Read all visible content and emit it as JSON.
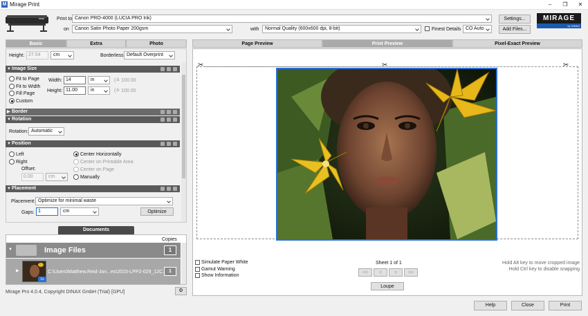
{
  "window": {
    "app_icon": "M",
    "title": "Mirage Print",
    "minimize": "–",
    "maximize": "❐",
    "close": "✕"
  },
  "header": {
    "print_to_label": "Print to",
    "printer": "Canon PRO-4000 (LUCIA PRO Ink)",
    "on_label": "on",
    "paper": "Canon Satin Photo Paper 200gsm",
    "with_label": "with",
    "quality": "Normal Quality (600x600 dpi, 8-bit)",
    "finest_details": "Finest Details",
    "color_mode": "CO Auto",
    "settings_button": "Settings...",
    "add_files_button": "Add Files...",
    "brand": "MIRAGE",
    "brand_sub": "by DINAX"
  },
  "left_tabs": [
    "Basic",
    "Extra",
    "Photo"
  ],
  "basic": {
    "height_label": "Height:",
    "height_value": "27.54",
    "height_unit": "cm",
    "borderless_label": "Borderless:",
    "borderless_value": "Default Overprint"
  },
  "sections": {
    "image_size": "Image Size",
    "border": "Border",
    "rotation": "Rotation",
    "position": "Position",
    "placement": "Placement"
  },
  "image_size": {
    "options": [
      "Fit to Page",
      "Fit to Width",
      "Fill Page",
      "Custom"
    ],
    "width_label": "Width:",
    "width_value": "14",
    "width_unit": "in",
    "width_pct": "(≙ 100.00",
    "height_label": "Height:",
    "height_value": "11.00",
    "height_unit": "in",
    "height_pct": "(≙ 100.00"
  },
  "rotation": {
    "label": "Rotation:",
    "value": "Automatic"
  },
  "position": {
    "left": "Left",
    "right": "Right",
    "offset_label": "Offset:",
    "offset_value": "0.00",
    "offset_unit": "cm",
    "center_h": "Center Horizontally",
    "center_printable": "Center on Printable Area",
    "center_page": "Center on Page",
    "manually": "Manually"
  },
  "placement": {
    "label": "Placement:",
    "value": "Optimize for minimal waste",
    "gaps_label": "Gaps:",
    "gaps_value": "1",
    "gaps_unit": "cm",
    "optimize_button": "Optimize"
  },
  "documents": {
    "tab": "Documents",
    "copies_header": "Copies",
    "group_name": "Image Files",
    "group_copies": "1",
    "file_path": "C:\\Users\\Matthew.Reid-Jon...es\\2015-LPP2-029_12C.tif",
    "file_copies": "1",
    "file_badge": "1x"
  },
  "footer": {
    "copyright": "Mirage Pro 4.0.4, Copyright DINAX GmbH (Trial) [GPU]",
    "gear_icon": "⚙"
  },
  "preview_tabs": [
    "Page Preview",
    "Print Preview",
    "Pixel-Exact Preview"
  ],
  "preview": {
    "scissors_icon": "✂"
  },
  "options": {
    "simulate_paper_white": "Simulate Paper White",
    "gamut_warning": "Gamut Warning",
    "show_information": "Show Information",
    "sheet_text": "Sheet 1 of 1",
    "nav_first": "<<",
    "nav_prev": "<",
    "nav_next": ">",
    "nav_last": ">>",
    "loupe_button": "Loupe",
    "hint1": "Hold Alt key to move cropped image",
    "hint2": "Hold Ctrl key to disable snapping"
  },
  "bottom_buttons": {
    "help": "Help",
    "close": "Close",
    "print": "Print"
  },
  "colors": {
    "accent_selection": "#2a6fd6",
    "section_header": "#5a5a5a",
    "brand_blue": "#1a5bb0"
  }
}
